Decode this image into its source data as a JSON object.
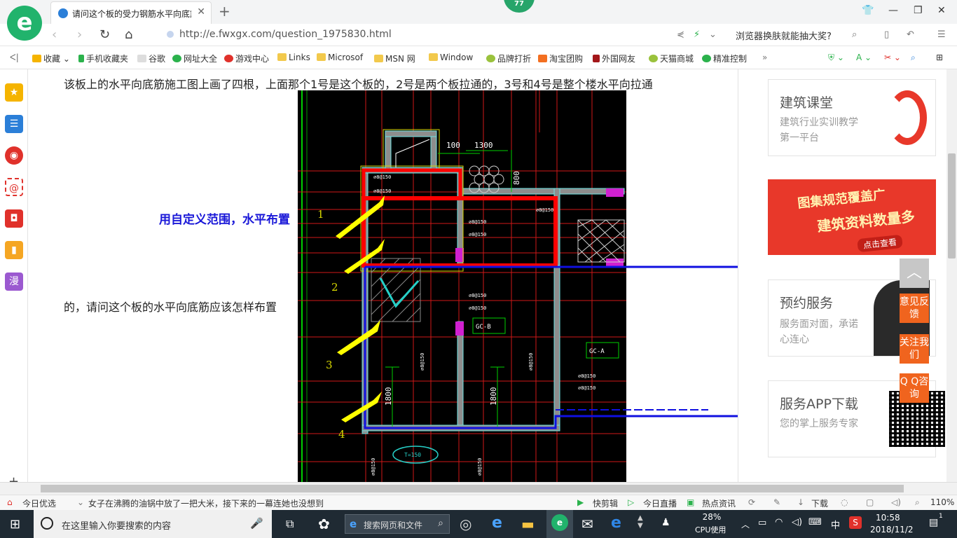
{
  "browser": {
    "tab_title": "请问这个板的受力钢筋水平向底筋",
    "new_tab_icon": "plus-icon",
    "badge_count": "77",
    "url": "http://e.fwxgx.com/question_1975830.html",
    "promo_text": "浏览器换肤就能抽大奖?"
  },
  "bookmarks": [
    {
      "label": "收藏"
    },
    {
      "label": "手机收藏夹"
    },
    {
      "label": "谷歌"
    },
    {
      "label": "网址大全"
    },
    {
      "label": "游戏中心"
    },
    {
      "label": "Links"
    },
    {
      "label": "Microsof"
    },
    {
      "label": "MSN 网"
    },
    {
      "label": "Window"
    },
    {
      "label": "品牌打折"
    },
    {
      "label": "淘宝团购"
    },
    {
      "label": "外国网友"
    },
    {
      "label": "天猫商城"
    },
    {
      "label": "精准控制"
    }
  ],
  "bookmark_more": "»",
  "sidebar": {
    "more_label": "漫",
    "add_label": "+"
  },
  "question": {
    "line1": "该板上的水平向底筋施工图上画了四根，上面那个1号是这个板的，2号是两个板拉通的，3号和4号是整个楼水平向拉通",
    "line2": "的，请问这个板的水平向底筋应该怎样布置",
    "annotation": "用自定义范围，水平布置"
  },
  "drawing": {
    "dim_100": "100",
    "dim_1300": "1300",
    "dim_800": "800",
    "dim_1800a": "1800",
    "dim_1800b": "1800",
    "rebar_label": "⌀8@150",
    "tag_gcb": "GC-B",
    "tag_gca": "GC-A",
    "ellipse_label": "T=150",
    "num1": "1",
    "num2": "2",
    "num3": "3",
    "num4": "4"
  },
  "cards": [
    {
      "title": "建筑课堂",
      "subtitle": "建筑行业实训教学第一平台"
    },
    {
      "title": "预约服务",
      "subtitle": "服务面对面，承诺心连心"
    },
    {
      "title": "服务APP下载",
      "subtitle": "您的掌上服务专家"
    }
  ],
  "banner": {
    "line1": "图集规范覆盖广",
    "line2": "建筑资料数量多",
    "cta": "点击查看"
  },
  "float_buttons": {
    "feedback": "意见反馈",
    "follow": "关注我们",
    "qq": "Q Q咨询"
  },
  "statusbar": {
    "today": "今日优选",
    "news": "女子在沸腾的油锅中放了一把大米，接下来的一幕连她也没想到",
    "kuaijian": "快剪辑",
    "live": "今日直播",
    "hot": "热点资讯",
    "download": "下载",
    "zoom": "110%"
  },
  "taskbar": {
    "search_placeholder": "在这里输入你要搜索的内容",
    "web_search": "搜索网页和文件",
    "cpu_percent": "28%",
    "cpu_label": "CPU使用",
    "ime": "中",
    "time": "10:58",
    "date": "2018/11/2",
    "notifications": "1"
  },
  "colors": {
    "brand_green": "#21b36c",
    "annotation_blue": "#1a18d8",
    "markup_red": "#ff0000",
    "markup_blue": "#1010e0",
    "arrow_yellow": "#ffff00",
    "float_orange": "#f0641e"
  }
}
